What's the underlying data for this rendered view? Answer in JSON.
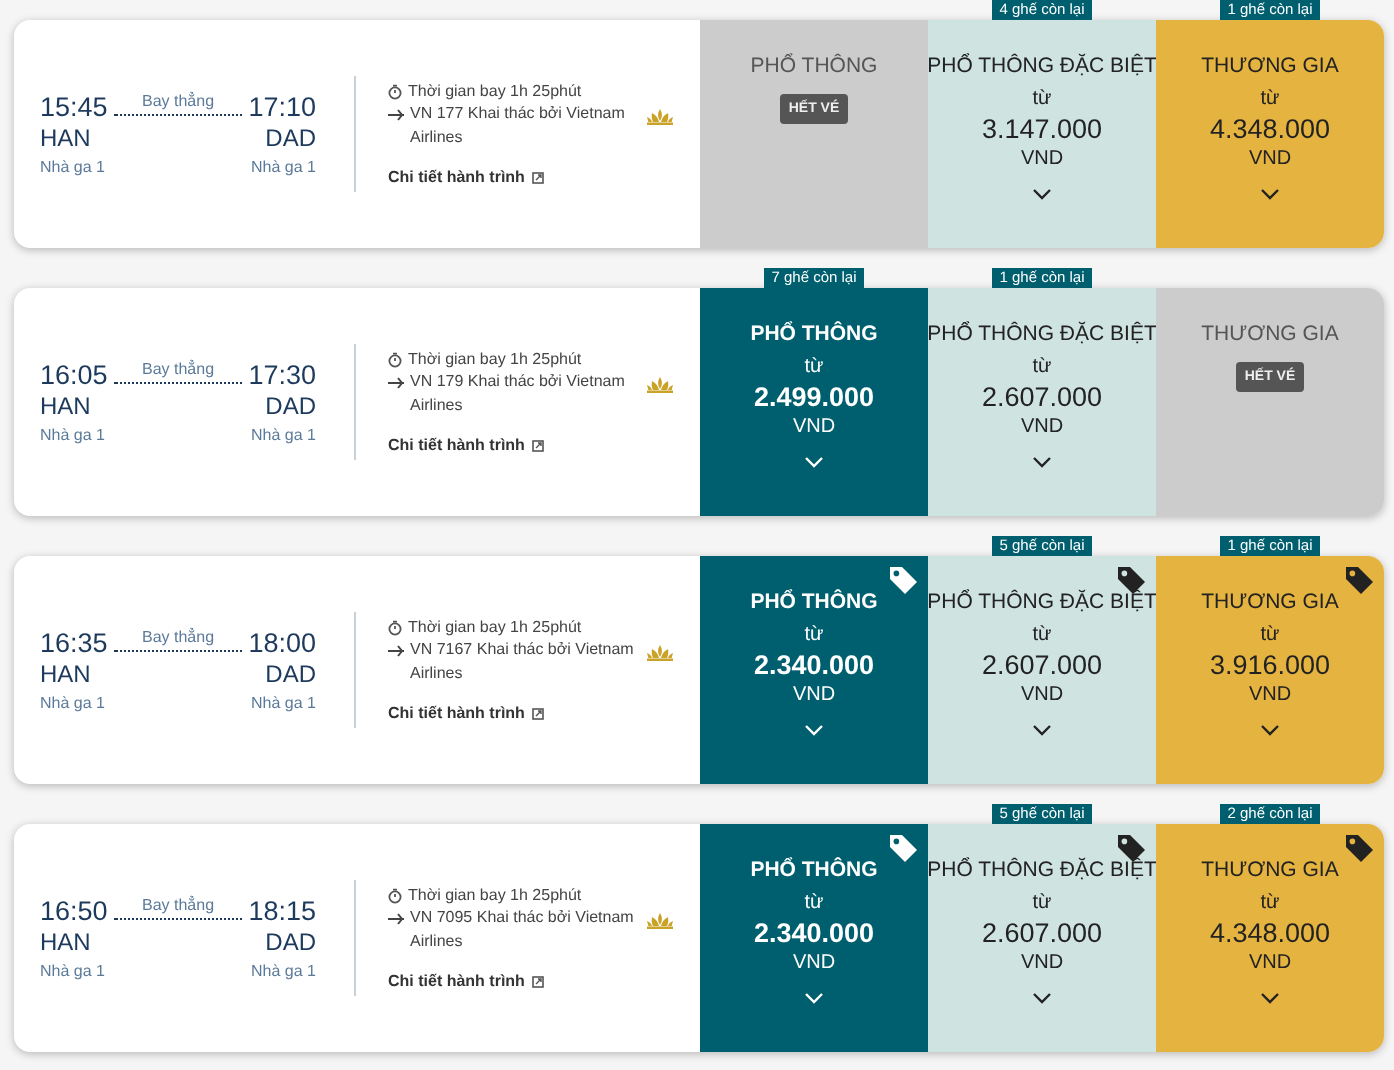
{
  "flights": [
    {
      "depart": {
        "time": "15:45",
        "airport": "HAN",
        "terminal": "Nhà ga 1"
      },
      "stop": "Bay thẳng",
      "arrive": {
        "time": "17:10",
        "airport": "DAD",
        "terminal": "Nhà ga 1"
      },
      "duration": "Thời gian bay 1h 25phút",
      "operator": "VN 177 Khai thác bởi Vietnam Airlines",
      "details": "Chi tiết hành trình",
      "fares": [
        {
          "kind": "economy",
          "name": "PHỔ THÔNG",
          "sold_out": true,
          "status": "HẾT VÉ",
          "promo": false
        },
        {
          "kind": "premium",
          "name": "PHỔ THÔNG ĐẶC BIỆT",
          "sold_out": false,
          "seats": "4 ghế còn lại",
          "from": "từ",
          "price": "3.147.000",
          "currency": "VND",
          "promo": false
        },
        {
          "kind": "business",
          "name": "THƯƠNG GIA",
          "sold_out": false,
          "seats": "1 ghế còn lại",
          "from": "từ",
          "price": "4.348.000",
          "currency": "VND",
          "promo": false
        }
      ]
    },
    {
      "depart": {
        "time": "16:05",
        "airport": "HAN",
        "terminal": "Nhà ga 1"
      },
      "stop": "Bay thẳng",
      "arrive": {
        "time": "17:30",
        "airport": "DAD",
        "terminal": "Nhà ga 1"
      },
      "duration": "Thời gian bay 1h 25phút",
      "operator": "VN 179 Khai thác bởi Vietnam Airlines",
      "details": "Chi tiết hành trình",
      "fares": [
        {
          "kind": "economy",
          "name": "PHỔ THÔNG",
          "sold_out": false,
          "seats": "7 ghế còn lại",
          "from": "từ",
          "price": "2.499.000",
          "currency": "VND",
          "promo": false
        },
        {
          "kind": "premium",
          "name": "PHỔ THÔNG ĐẶC BIỆT",
          "sold_out": false,
          "seats": "1 ghế còn lại",
          "from": "từ",
          "price": "2.607.000",
          "currency": "VND",
          "promo": false
        },
        {
          "kind": "business",
          "name": "THƯƠNG GIA",
          "sold_out": true,
          "status": "HẾT VÉ",
          "promo": false
        }
      ]
    },
    {
      "depart": {
        "time": "16:35",
        "airport": "HAN",
        "terminal": "Nhà ga 1"
      },
      "stop": "Bay thẳng",
      "arrive": {
        "time": "18:00",
        "airport": "DAD",
        "terminal": "Nhà ga 1"
      },
      "duration": "Thời gian bay 1h 25phút",
      "operator": "VN 7167 Khai thác bởi Vietnam Airlines",
      "details": "Chi tiết hành trình",
      "fares": [
        {
          "kind": "economy",
          "name": "PHỔ THÔNG",
          "sold_out": false,
          "from": "từ",
          "price": "2.340.000",
          "currency": "VND",
          "promo": true
        },
        {
          "kind": "premium",
          "name": "PHỔ THÔNG ĐẶC BIỆT",
          "sold_out": false,
          "seats": "5 ghế còn lại",
          "from": "từ",
          "price": "2.607.000",
          "currency": "VND",
          "promo": true
        },
        {
          "kind": "business",
          "name": "THƯƠNG GIA",
          "sold_out": false,
          "seats": "1 ghế còn lại",
          "from": "từ",
          "price": "3.916.000",
          "currency": "VND",
          "promo": true
        }
      ]
    },
    {
      "depart": {
        "time": "16:50",
        "airport": "HAN",
        "terminal": "Nhà ga 1"
      },
      "stop": "Bay thẳng",
      "arrive": {
        "time": "18:15",
        "airport": "DAD",
        "terminal": "Nhà ga 1"
      },
      "duration": "Thời gian bay 1h 25phút",
      "operator": "VN 7095 Khai thác bởi Vietnam Airlines",
      "details": "Chi tiết hành trình",
      "fares": [
        {
          "kind": "economy",
          "name": "PHỔ THÔNG",
          "sold_out": false,
          "from": "từ",
          "price": "2.340.000",
          "currency": "VND",
          "promo": true
        },
        {
          "kind": "premium",
          "name": "PHỔ THÔNG ĐẶC BIỆT",
          "sold_out": false,
          "seats": "5 ghế còn lại",
          "from": "từ",
          "price": "2.607.000",
          "currency": "VND",
          "promo": true
        },
        {
          "kind": "business",
          "name": "THƯƠNG GIA",
          "sold_out": false,
          "seats": "2 ghế còn lại",
          "from": "từ",
          "price": "4.348.000",
          "currency": "VND",
          "promo": true
        }
      ]
    }
  ]
}
